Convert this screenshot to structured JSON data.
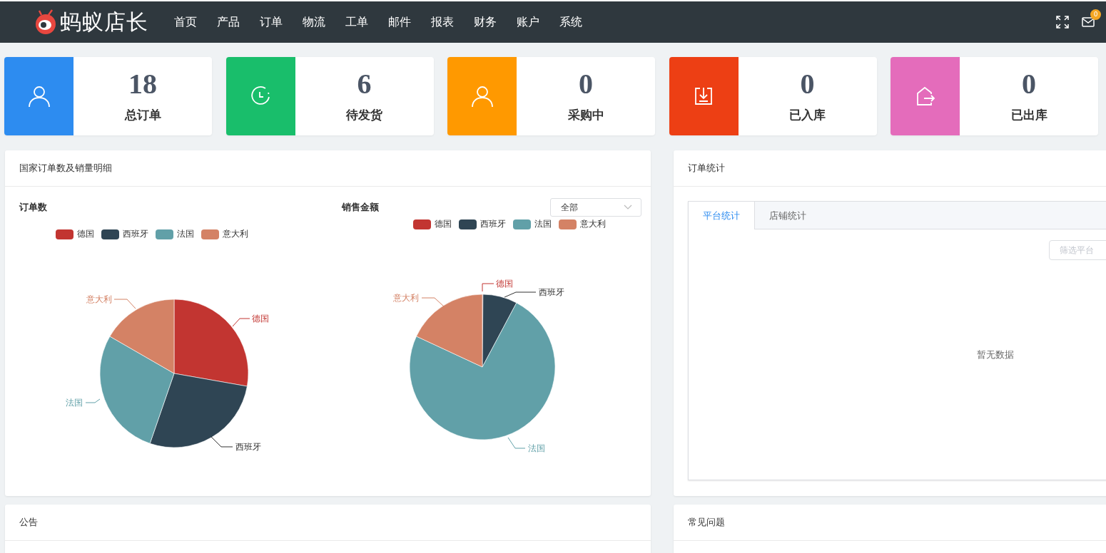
{
  "header": {
    "logo_text": "蚂蚁店长",
    "nav": [
      "首页",
      "产品",
      "订单",
      "物流",
      "工单",
      "邮件",
      "报表",
      "财务",
      "账户",
      "系统"
    ],
    "mail_badge": "0"
  },
  "stats": [
    {
      "value": "18",
      "label": "总订单",
      "color": "#2d8cf0"
    },
    {
      "value": "6",
      "label": "待发货",
      "color": "#19be6b"
    },
    {
      "value": "0",
      "label": "采购中",
      "color": "#ff9900"
    },
    {
      "value": "0",
      "label": "已入库",
      "color": "#ed3f14"
    },
    {
      "value": "0",
      "label": "已出库",
      "color": "#e46cbb"
    }
  ],
  "country_panel": {
    "title": "国家订单数及销量明细",
    "filter": "全部",
    "charts": [
      {
        "title": "订单数",
        "legend": [
          {
            "name": "德国",
            "color": "#c23531"
          },
          {
            "name": "西班牙",
            "color": "#2f4554"
          },
          {
            "name": "法国",
            "color": "#61a0a8"
          },
          {
            "name": "意大利",
            "color": "#d48265"
          }
        ],
        "slice_labels": [
          "德国",
          "西班牙",
          "法国",
          "意大利"
        ]
      },
      {
        "title": "销售金额",
        "legend": [
          {
            "name": "德国",
            "color": "#c23531"
          },
          {
            "name": "西班牙",
            "color": "#2f4554"
          },
          {
            "name": "法国",
            "color": "#61a0a8"
          },
          {
            "name": "意大利",
            "color": "#d48265"
          }
        ],
        "slice_labels": [
          "德国",
          "西班牙",
          "法国",
          "意大利"
        ]
      }
    ]
  },
  "order_panel": {
    "title": "订单统计",
    "tabs": [
      {
        "label": "平台统计",
        "selected": true
      },
      {
        "label": "店铺统计",
        "selected": false
      }
    ],
    "filter_placeholder": "筛选平台",
    "empty_text": "暂无数据"
  },
  "notice_panel": {
    "title": "公告"
  },
  "faq_panel": {
    "title": "常见问题"
  }
}
